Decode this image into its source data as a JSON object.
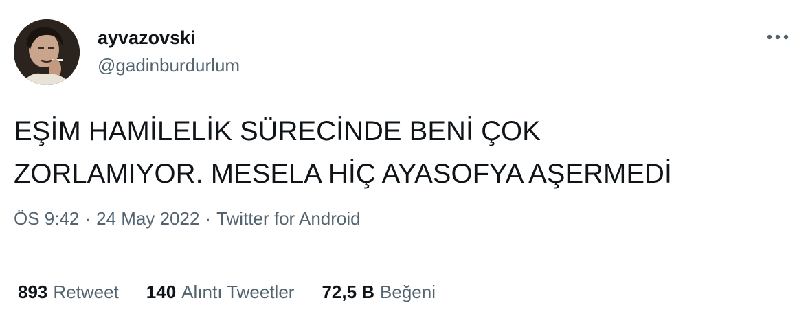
{
  "user": {
    "display_name": "ayvazovski",
    "handle": "@gadinburdurlum",
    "avatar_icon": "profile-photo"
  },
  "more_icon": "more-horizontal-icon",
  "tweet": {
    "lines": [
      "EŞİM HAMİLELİK SÜRECİNDE BENİ ÇOK",
      "ZORLAMIYOR. MESELA HİÇ AYASOFYA AŞERMEDİ"
    ]
  },
  "meta": {
    "time": "ÖS 9:42",
    "separator": "·",
    "date": "24 May 2022",
    "source": "Twitter for Android"
  },
  "stats": {
    "retweets": {
      "count": "893",
      "label": "Retweet"
    },
    "quotes": {
      "count": "140",
      "label": "Alıntı Tweetler"
    },
    "likes": {
      "count": "72,5 B",
      "label": "Beğeni"
    }
  },
  "colors": {
    "text_primary": "#0f1419",
    "text_secondary": "#536471",
    "divider": "#eff3f4"
  }
}
